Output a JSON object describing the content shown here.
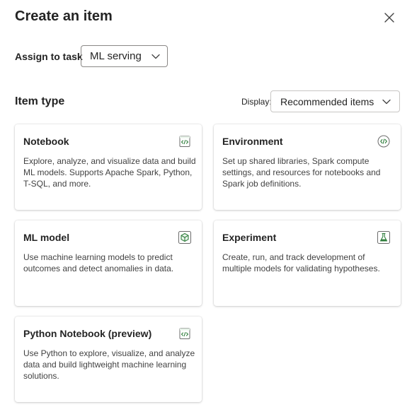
{
  "dialog": {
    "title": "Create an item",
    "close_icon": "close-icon"
  },
  "assign": {
    "label": "Assign to task",
    "value": "ML serving"
  },
  "item_type": {
    "heading": "Item type",
    "display_label": "Display:",
    "display_value": "Recommended items"
  },
  "cards": [
    {
      "title": "Notebook",
      "description": "Explore, analyze, and visualize data and build ML models. Supports Apache Spark, Python, T-SQL, and more.",
      "icon": "notebook-icon"
    },
    {
      "title": "Environment",
      "description": "Set up shared libraries, Spark compute settings, and resources for notebooks and Spark job definitions.",
      "icon": "environment-icon"
    },
    {
      "title": "ML model",
      "description": "Use machine learning models to predict outcomes and detect anomalies in data.",
      "icon": "ml-model-icon"
    },
    {
      "title": "Experiment",
      "description": "Create, run, and track development of multiple models for validating hypotheses.",
      "icon": "experiment-icon"
    },
    {
      "title": "Python Notebook (preview)",
      "description": "Use Python to explore, visualize, and analyze data and build lightweight machine learning solutions.",
      "icon": "python-notebook-icon"
    }
  ],
  "colors": {
    "icon_green": "#2d7d3a",
    "text": "#242424"
  }
}
